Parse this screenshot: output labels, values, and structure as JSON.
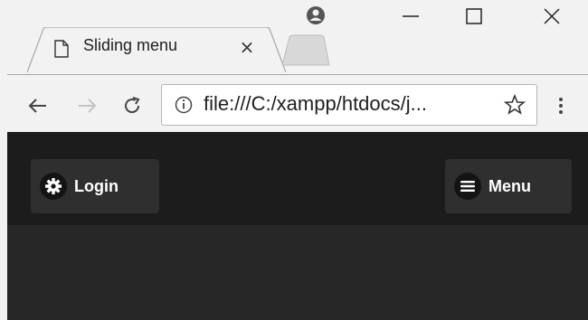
{
  "browser": {
    "tab": {
      "title": "Sliding menu",
      "close_glyph": "×"
    },
    "address": {
      "url": "file:///C:/xampp/htdocs/j..."
    },
    "icons": {
      "document": "document-icon",
      "profile": "profile-icon",
      "minimize": "minimize-icon",
      "maximize": "maximize-icon",
      "close": "close-icon",
      "back": "back-arrow-icon",
      "forward": "forward-arrow-icon",
      "reload": "reload-icon",
      "info": "info-icon",
      "star": "star-icon",
      "menu": "more-vertical-icon"
    }
  },
  "page": {
    "login_button": {
      "label": "Login",
      "icon": "gear-icon"
    },
    "menu_button": {
      "label": "Menu",
      "icon": "hamburger-icon"
    },
    "colors": {
      "header": "#1c1c1c",
      "body": "#272727",
      "button": "#2f2f2f"
    }
  }
}
